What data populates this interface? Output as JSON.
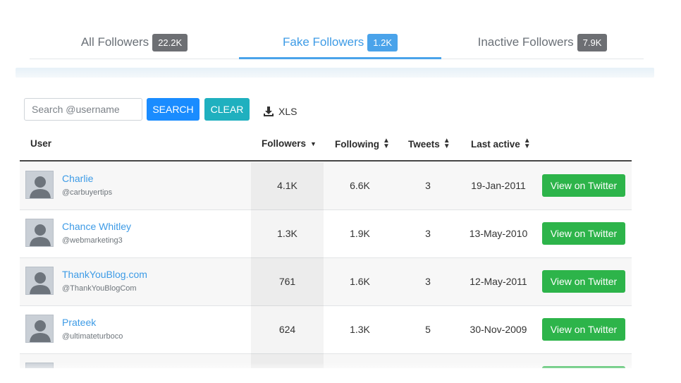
{
  "tabs": [
    {
      "label": "All Followers",
      "count": "22.2K",
      "active": false
    },
    {
      "label": "Fake Followers",
      "count": "1.2K",
      "active": true
    },
    {
      "label": "Inactive Followers",
      "count": "7.9K",
      "active": false
    }
  ],
  "toolbar": {
    "search_placeholder": "Search @username",
    "search_label": "SEARCH",
    "clear_label": "CLEAR",
    "export_label": "XLS"
  },
  "table": {
    "columns": [
      "User",
      "Followers",
      "Following",
      "Tweets",
      "Last active"
    ],
    "sorted_column": "Followers",
    "sort_direction": "descending",
    "action_label": "View on Twitter",
    "rows": [
      {
        "name": "Charlie",
        "handle": "@carbuyertips",
        "followers": "4.1K",
        "following": "6.6K",
        "tweets": "3",
        "last_active": "19-Jan-2011"
      },
      {
        "name": "Chance Whitley",
        "handle": "@webmarketing3",
        "followers": "1.3K",
        "following": "1.9K",
        "tweets": "3",
        "last_active": "13-May-2010"
      },
      {
        "name": "ThankYouBlog.com",
        "handle": "@ThankYouBlogCom",
        "followers": "761",
        "following": "1.6K",
        "tweets": "3",
        "last_active": "12-May-2011"
      },
      {
        "name": "Prateek",
        "handle": "@ultimateturboco",
        "followers": "624",
        "following": "1.3K",
        "tweets": "5",
        "last_active": "30-Nov-2009"
      },
      {
        "name": "",
        "handle": "",
        "followers": "",
        "following": "",
        "tweets": "",
        "last_active": ""
      }
    ]
  },
  "colors": {
    "accent": "#4aa3ea",
    "search_button": "#1a8cff",
    "clear_button": "#1fb0bf",
    "view_button": "#2db44a",
    "badge_inactive": "#6d6f73"
  }
}
